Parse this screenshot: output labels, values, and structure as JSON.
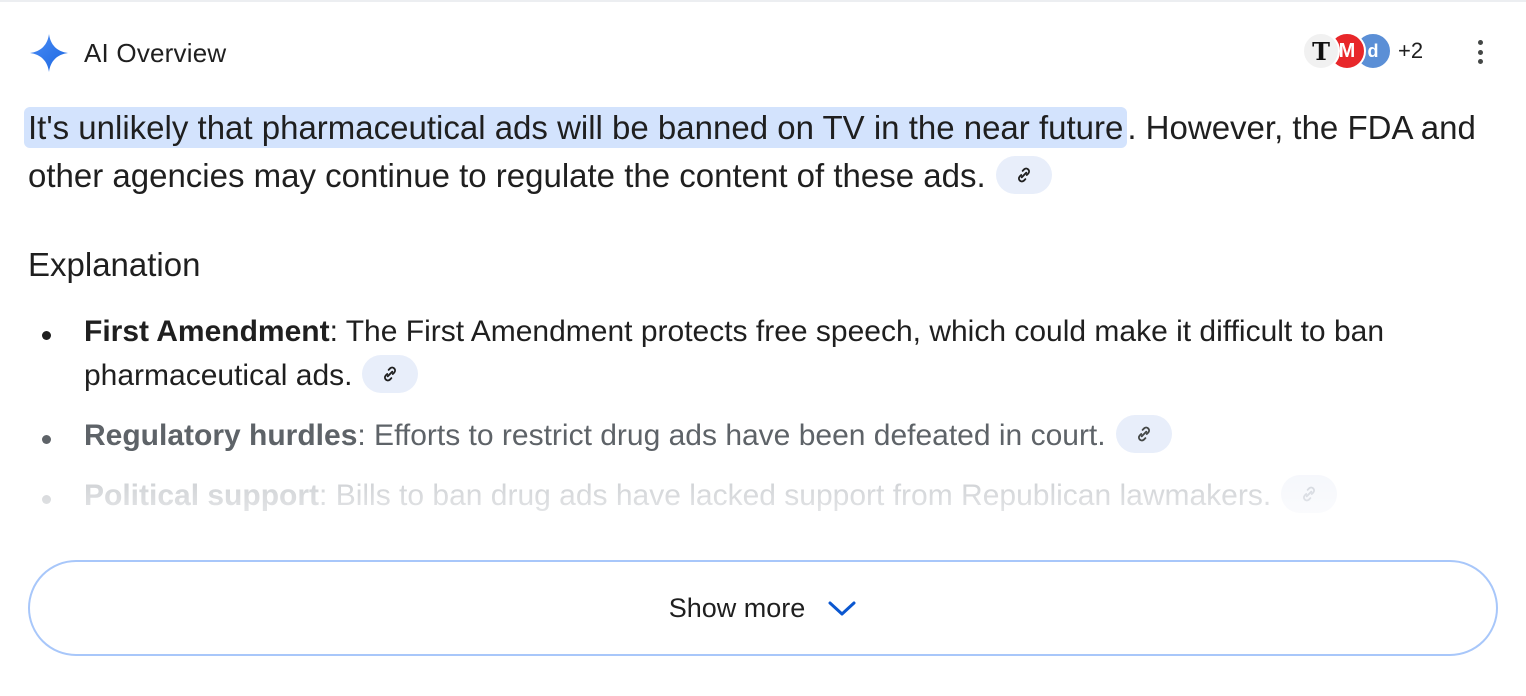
{
  "header": {
    "title": "AI Overview",
    "sources": {
      "logos": [
        {
          "label": "T",
          "color": "#f1f1f1"
        },
        {
          "label": "M",
          "color": "#e8272a"
        },
        {
          "label": "d",
          "color": "#5b8fd6"
        }
      ],
      "more_count": "+2"
    }
  },
  "overview": {
    "highlighted": "It's unlikely that pharmaceutical ads will be banned on TV in the near future",
    "rest": ". However, the FDA and other agencies may continue to regulate the content of these ads."
  },
  "explanation": {
    "heading": "Explanation",
    "items": [
      {
        "term": "First Amendment",
        "text": ": The First Amendment protects free speech, which could make it difficult to ban pharmaceutical ads."
      },
      {
        "term": "Regulatory hurdles",
        "text": ": Efforts to restrict drug ads have been defeated in court."
      },
      {
        "term": "Political support",
        "text": ": Bills to ban drug ads have lacked support from Republican lawmakers."
      }
    ]
  },
  "show_more": {
    "label": "Show more"
  },
  "colors": {
    "accent": "#0b57d0",
    "highlight": "#d3e3fd",
    "chip": "#e8eefa",
    "button_border": "#a8c7fa"
  }
}
